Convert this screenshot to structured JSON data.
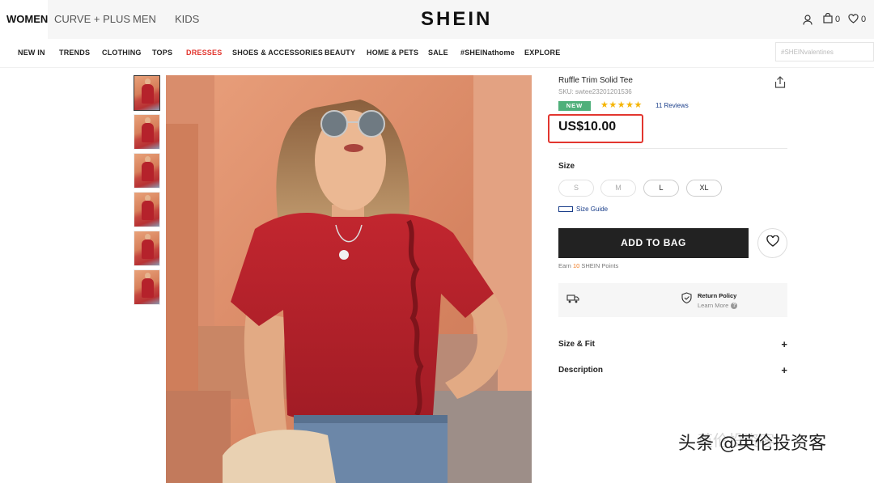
{
  "header": {
    "gender_tabs": [
      "WOMEN",
      "CURVE + PLUS",
      "MEN",
      "KIDS"
    ],
    "logo": "SHEIN",
    "bag_count": "0",
    "wish_count": "0"
  },
  "nav": {
    "items": [
      "NEW IN",
      "TRENDS",
      "CLOTHING",
      "TOPS",
      "DRESSES",
      "SHOES & ACCESSORIES",
      "BEAUTY",
      "HOME & PETS",
      "SALE",
      "#SHEINathome",
      "EXPLORE"
    ],
    "search_placeholder": "#SHEINvalentines",
    "highlight_color": "#e2362f"
  },
  "product": {
    "title": "Ruffle Trim Solid Tee",
    "sku": "SKU: swtee23201201536",
    "badge": "NEW",
    "stars": "★★★★★",
    "reviews": "11 Reviews",
    "price": "US$10.00",
    "size_label": "Size",
    "sizes": [
      "S",
      "M",
      "L",
      "XL"
    ],
    "size_guide": "Size Guide",
    "add_to_bag": "ADD TO BAG",
    "points_prefix": "Earn ",
    "points_value": "10",
    "points_suffix": " SHEIN Points",
    "return_policy": "Return Policy",
    "learn_more": "Learn More",
    "accordion": [
      "Size & Fit",
      "Description"
    ]
  },
  "watermark": {
    "ghost": "英伦投资客",
    "text": "头条 @英伦投资客"
  },
  "colors": {
    "price_highlight": "#e2362f",
    "new_badge": "#4fb07a",
    "stars": "#f5b400",
    "link": "#1a3e8a"
  }
}
